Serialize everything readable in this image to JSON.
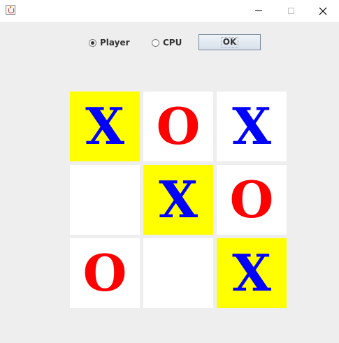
{
  "window": {
    "icon": "java-cup-icon",
    "controls": {
      "minimize_icon": "minimize-icon",
      "maximize_icon": "maximize-icon",
      "close_icon": "close-icon"
    }
  },
  "controls": {
    "player_label": "Player",
    "player_selected": true,
    "cpu_label": "CPU",
    "cpu_selected": false,
    "ok_label": "OK"
  },
  "board": {
    "cells": [
      {
        "mark": "X",
        "highlight": true
      },
      {
        "mark": "O",
        "highlight": false
      },
      {
        "mark": "X",
        "highlight": false
      },
      {
        "mark": "",
        "highlight": false
      },
      {
        "mark": "X",
        "highlight": true
      },
      {
        "mark": "O",
        "highlight": false
      },
      {
        "mark": "O",
        "highlight": false
      },
      {
        "mark": "",
        "highlight": false
      },
      {
        "mark": "X",
        "highlight": true
      }
    ]
  },
  "colors": {
    "x_color": "#0000ff",
    "o_color": "#ff0000",
    "highlight_bg": "#ffff00",
    "cell_bg": "#ffffff",
    "panel_bg": "#eeeeee"
  }
}
